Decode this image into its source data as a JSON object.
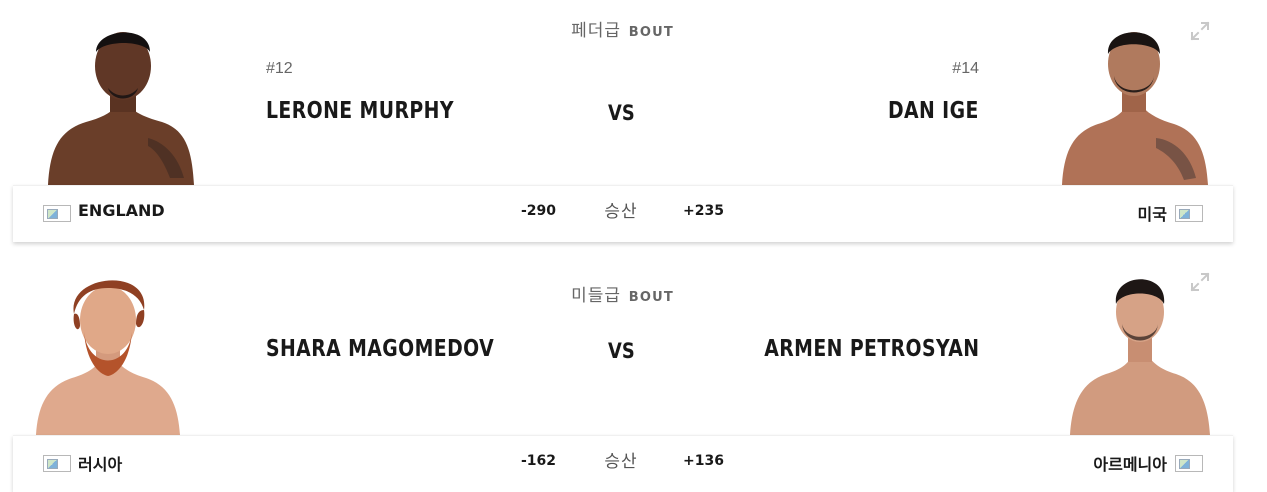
{
  "bouts": [
    {
      "weight_class": "페더급",
      "bout_word": "BOUT",
      "red": {
        "rank": "#12",
        "name": "LERONE MURPHY",
        "country": "ENGLAND",
        "odds": "-290"
      },
      "blue": {
        "rank": "#14",
        "name": "DAN IGE",
        "country": "미국",
        "odds": "+235"
      },
      "vs": "VS",
      "odds_label": "승산"
    },
    {
      "weight_class": "미들급",
      "bout_word": "BOUT",
      "red": {
        "rank": "",
        "name": "SHARA MAGOMEDOV",
        "country": "러시아",
        "odds": "-162"
      },
      "blue": {
        "rank": "",
        "name": "ARMEN PETROSYAN",
        "country": "아르메니아",
        "odds": "+136"
      },
      "vs": "VS",
      "odds_label": "승산"
    }
  ]
}
